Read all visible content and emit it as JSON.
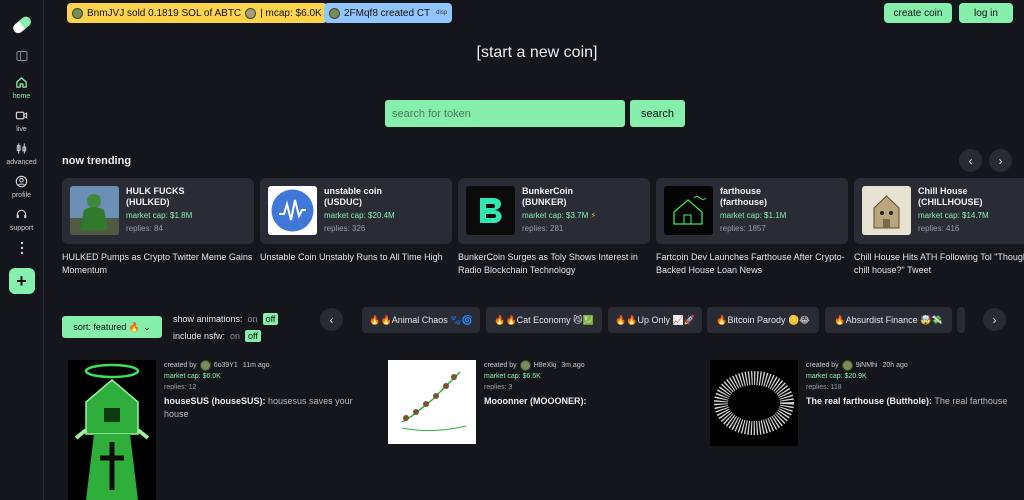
{
  "ticker": [
    {
      "text": "BnmJVJ sold 0.1819 SOL of ABTC",
      "suffix": "| mcap: $6.0K"
    },
    {
      "text": "2FMqf8 created CT",
      "tag": "disp"
    }
  ],
  "header": {
    "create_label": "create coin",
    "login_label": "log in",
    "start_label": "[start a new coin]"
  },
  "search": {
    "placeholder": "search for token",
    "button": "search"
  },
  "sidebar": {
    "items": [
      {
        "label": "home"
      },
      {
        "label": "live"
      },
      {
        "label": "advanced"
      },
      {
        "label": "profile"
      },
      {
        "label": "support"
      }
    ],
    "plus": "+"
  },
  "trending": {
    "title": "now trending",
    "items": [
      {
        "name": "HULK FUCKS",
        "ticker": "(HULKED)",
        "cap": "market cap: $1.8M",
        "replies": "replies: 84",
        "caption": "HULKED Pumps as Crypto Twitter Meme Gains Momentum"
      },
      {
        "name": "unstable coin",
        "ticker": "(USDUC)",
        "cap": "market cap: $20.4M",
        "replies": "replies: 326",
        "caption": "Unstable Coin Unstably Runs to All Time High"
      },
      {
        "name": "BunkerCoin",
        "ticker": "(BUNKER)",
        "cap": "market cap: $3.7M",
        "replies": "replies: 281",
        "caption": "BunkerCoin Surges as Toly Shows Interest in Radio Blockchain Technology"
      },
      {
        "name": "farthouse",
        "ticker": "(farthouse)",
        "cap": "market cap: $1.1M",
        "replies": "replies: 1857",
        "caption": "Fartcoin Dev Launches Farthouse After Crypto-Backed House Loan News"
      },
      {
        "name": "Chill House",
        "ticker": "(CHILLHOUSE)",
        "cap": "market cap: $14.7M",
        "replies": "replies: 416",
        "caption": "Chill House Hits ATH Following Tol \"Thoughts on chill house?\" Tweet"
      }
    ]
  },
  "filters": {
    "sort": "sort: featured 🔥",
    "animations_label": "show animations:",
    "animations_on": "on",
    "animations_off": "off",
    "nsfw_label": "include nsfw:",
    "nsfw_on": "on",
    "nsfw_off": "off"
  },
  "categories": [
    "🔥🔥Animal Chaos 🐾🌀",
    "🔥🔥Cat Economy 😼💹",
    "🔥🔥Up Only 📈🚀",
    "🔥Bitcoin Parody 🪙😂",
    "🔥Absurdist Finance 🤯💸"
  ],
  "coins": [
    {
      "creator_prefix": "created by",
      "creator": "6o39Y1",
      "time": "11m ago",
      "cap": "market cap: $6.0K",
      "replies": "replies: 12",
      "name": "houseSUS (houseSUS):",
      "desc": "housesus saves your house"
    },
    {
      "creator_prefix": "created by",
      "creator": "H8eXkj",
      "time": "3m ago",
      "cap": "market cap: $6.5K",
      "replies": "replies: 3",
      "name": "Mooonner (MOOONER):",
      "desc": ""
    },
    {
      "creator_prefix": "created by",
      "creator": "9iNMhi",
      "time": "20h ago",
      "cap": "market cap: $20.9K",
      "replies": "replies: 118",
      "name": "The real farthouse (Butthole):",
      "desc": "The real farthouse"
    }
  ],
  "colors": {
    "accent": "#86efac",
    "bg": "#15161b",
    "card": "#2a2c35",
    "ticker_yellow": "#fcd34d",
    "ticker_blue": "#93c5fd"
  }
}
